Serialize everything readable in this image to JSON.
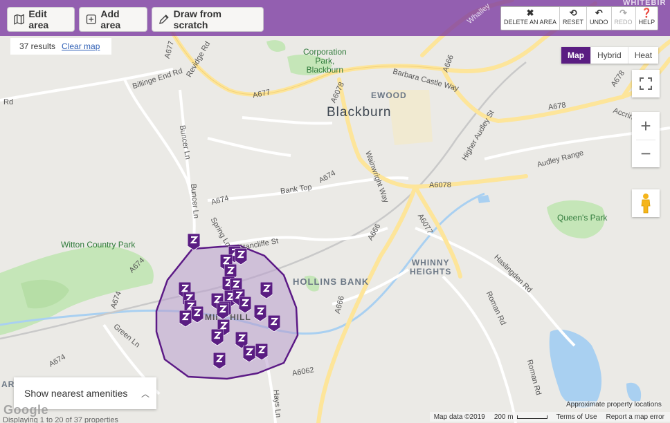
{
  "toolbar": {
    "edit_area": "Edit area",
    "add_area": "Add area",
    "draw_from_scratch": "Draw from scratch"
  },
  "map_controls": {
    "delete_area": "DELETE AN AREA",
    "reset": "RESET",
    "undo": "UNDO",
    "redo": "REDO",
    "help": "HELP"
  },
  "results": {
    "count": "37 results",
    "clear_map": "Clear map"
  },
  "map_types": [
    "Map",
    "Hybrid",
    "Heat"
  ],
  "map_type_active": "Map",
  "amenities": {
    "label": "Show nearest amenities"
  },
  "labels": {
    "blackburn": "Blackburn",
    "ewood": "EWOOD",
    "hollins_bank": "HOLLINS BANK",
    "whinny_heights": "WHINNY\nHEIGHTS",
    "mill_hill": "MILL HILL",
    "corporation_park": "Corporation\nPark,\nBlackburn",
    "queens_park": "Queen's Park",
    "witton_country_park": "Witton Country Park",
    "whitebirk": "WHITEBIR",
    "arr": "ARR",
    "roads": {
      "a677_1": "A677",
      "a677_2": "A677",
      "revidge_rd": "Revidge Rd",
      "billinge_end_rd": "Billinge End Rd",
      "rd_left": "Rd",
      "buncer_ln": "Buncer Ln",
      "buncer_ln_2": "Buncer Ln",
      "a674_1": "A674",
      "a674_2": "A674",
      "a674_3": "A674",
      "a674_4": "A674",
      "a674_5": "A674",
      "bank_top": "Bank Top",
      "spring_ln": "Spring Ln",
      "stancliffe_st": "Stancliffe St",
      "a6078_1": "A6078",
      "a6078_2": "A6078",
      "a666_1": "A666",
      "a666_2": "A666",
      "a666_3": "A666",
      "a6077": "A6077",
      "barbara_castle_way": "Barbara Castle Way",
      "wainwright_way": "Wainwright Way",
      "a678_1": "A678",
      "a678_2": "A678",
      "higher_audley_st": "Higher Audley St",
      "audley_range": "Audley Range",
      "accring": "Accring",
      "haslingden_rd": "Haslingden Rd",
      "roman_rd_1": "Roman Rd",
      "roman_rd_2": "Roman Rd",
      "green_ln": "Green Ln",
      "a6062": "A6062",
      "hays_ln": "Hays Ln",
      "whalley": "Whalley"
    }
  },
  "attribution": {
    "approx": "Approximate property locations",
    "map_data": "Map data ©2019",
    "scale": "200 m",
    "terms": "Terms of Use",
    "report": "Report a map error"
  },
  "logo": "Google",
  "caption": "Displaying 1 to 20 of 37 properties",
  "colors": {
    "accent": "#5a1d82",
    "polygon_fill": "#b89ccc",
    "polygon_stroke": "#5c1a86",
    "major_road": "#fde59a",
    "park": "#c5e6b8",
    "water": "#a9d0f1"
  },
  "markers": [
    {
      "icon": "z-marker"
    },
    {
      "icon": "z-marker"
    },
    {
      "icon": "z-marker"
    },
    {
      "icon": "z-marker"
    },
    {
      "icon": "z-marker"
    },
    {
      "icon": "z-marker"
    },
    {
      "icon": "z-marker"
    },
    {
      "icon": "z-marker"
    },
    {
      "icon": "z-marker"
    },
    {
      "icon": "z-marker"
    },
    {
      "icon": "z-marker"
    },
    {
      "icon": "z-marker"
    },
    {
      "icon": "z-marker"
    },
    {
      "icon": "z-marker"
    },
    {
      "icon": "z-marker"
    },
    {
      "icon": "z-marker"
    },
    {
      "icon": "z-marker"
    },
    {
      "icon": "z-marker"
    },
    {
      "icon": "z-marker"
    },
    {
      "icon": "z-marker"
    },
    {
      "icon": "z-marker"
    },
    {
      "icon": "z-marker"
    },
    {
      "icon": "z-marker"
    },
    {
      "icon": "z-marker"
    },
    {
      "icon": "z-marker"
    },
    {
      "icon": "z-marker"
    },
    {
      "icon": "z-marker"
    }
  ]
}
